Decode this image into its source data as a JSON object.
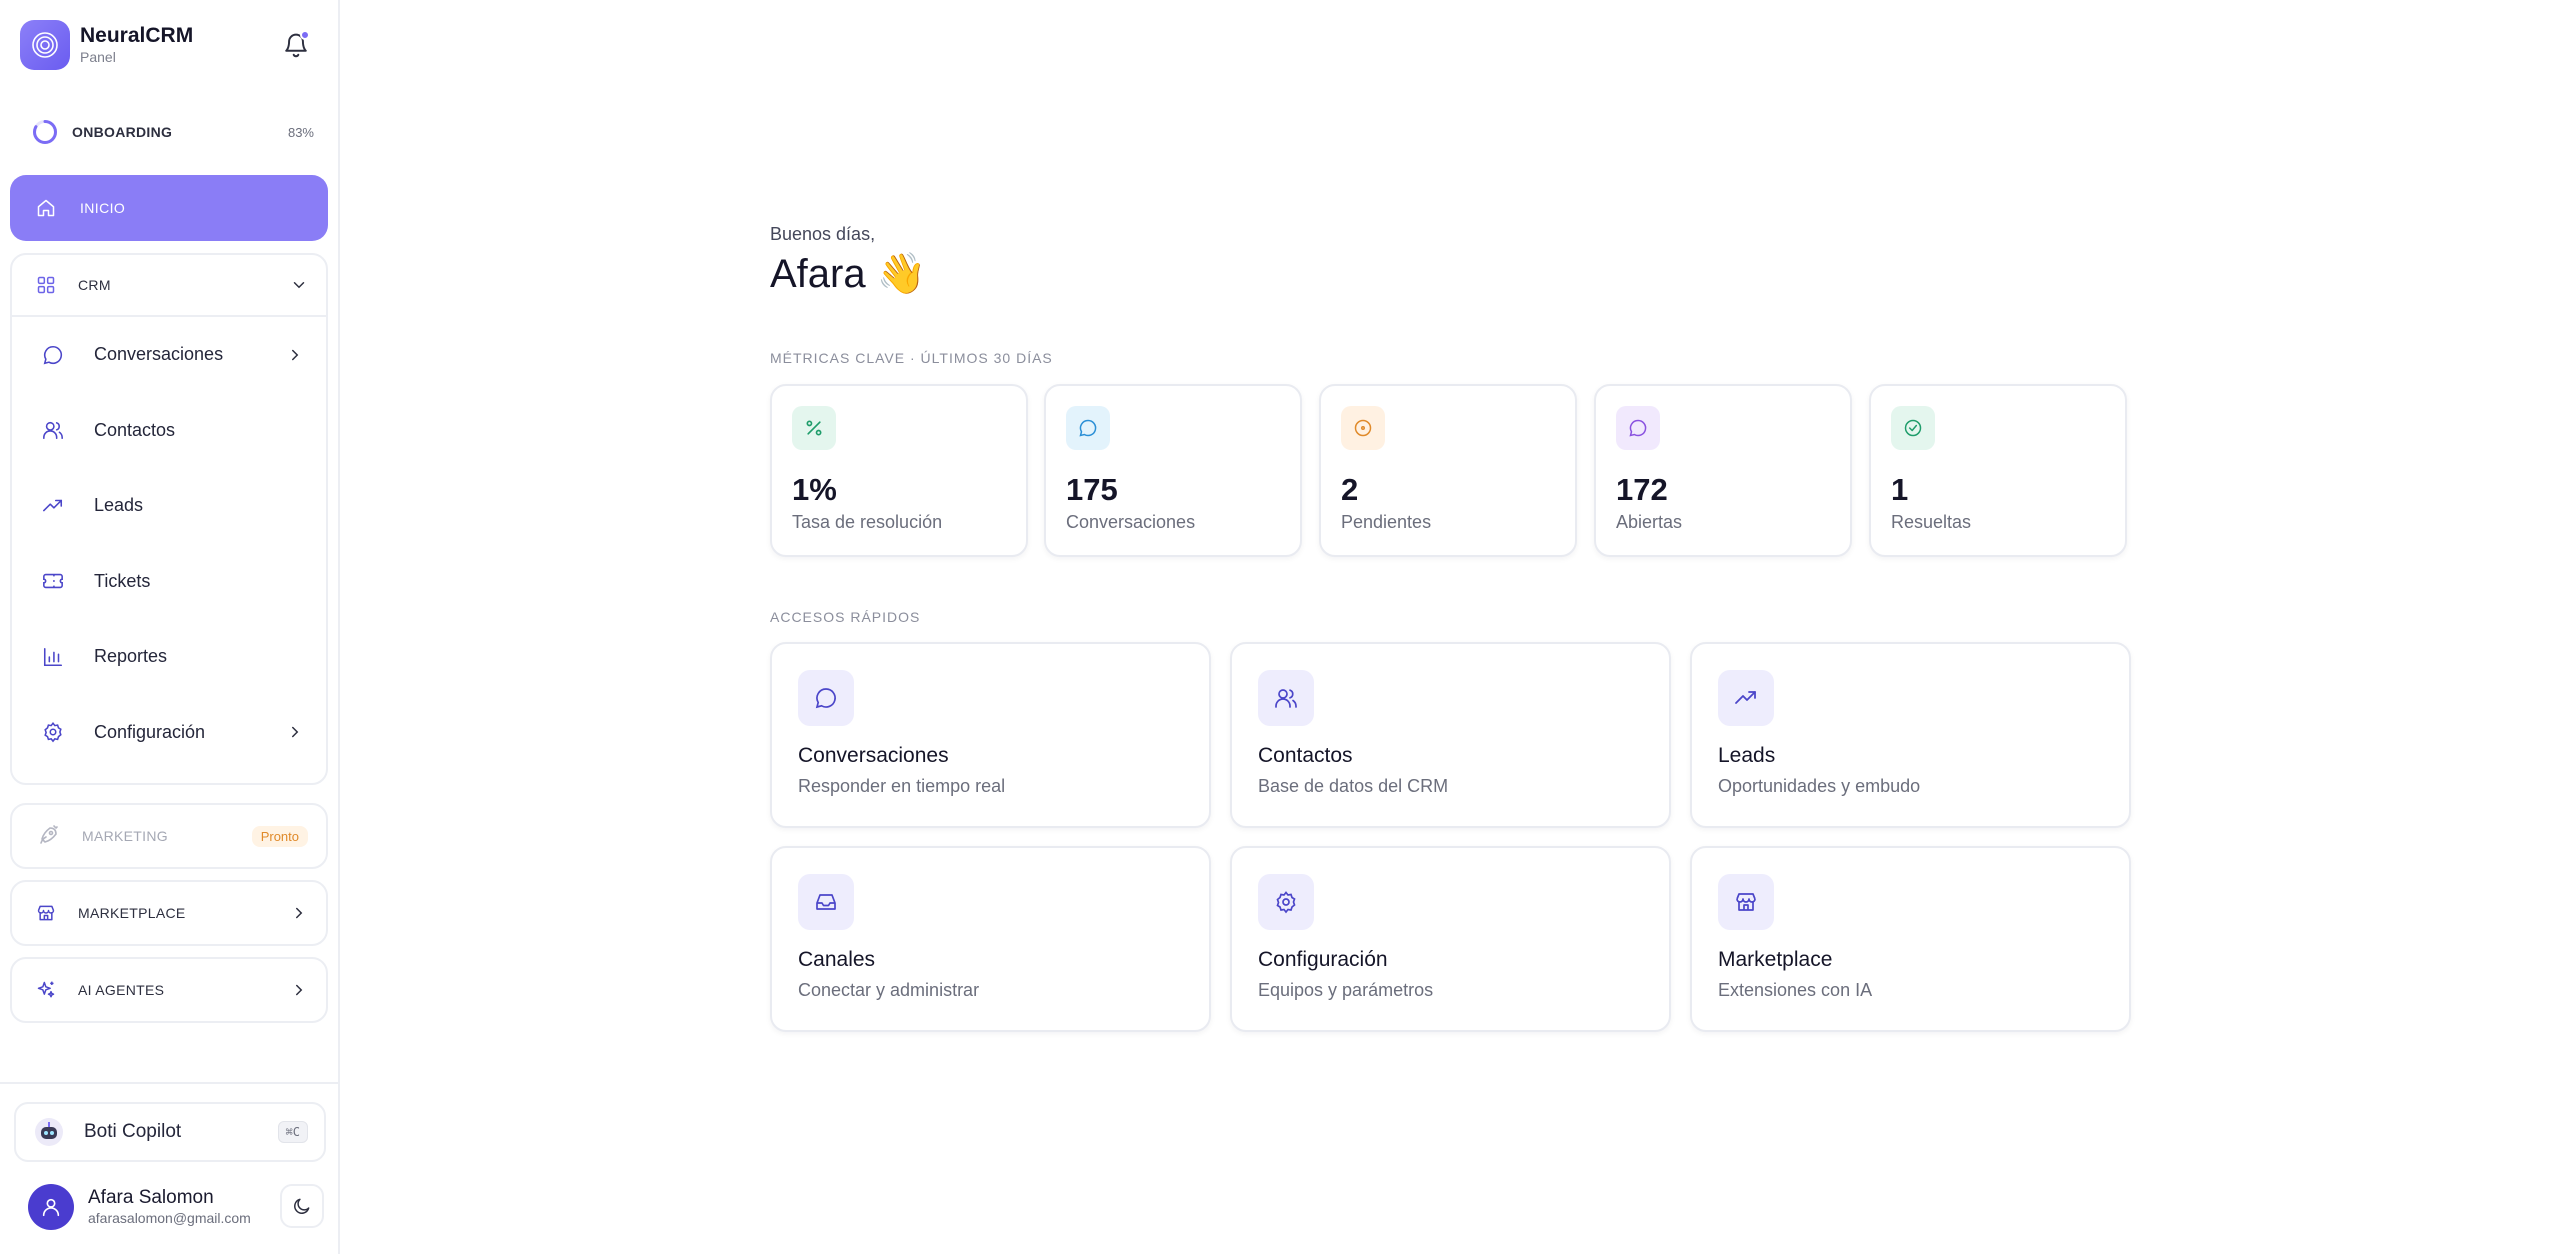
{
  "brand": {
    "name": "NeuralCRM",
    "subtitle": "Panel"
  },
  "onboarding": {
    "label": "ONBOARDING",
    "percent_text": "83%",
    "progress": 0.83
  },
  "nav": {
    "home_label": "INICIO",
    "crm_label": "CRM",
    "crm_items": [
      {
        "label": "Conversaciones",
        "icon": "chat-bubble-icon",
        "has_chevron": true
      },
      {
        "label": "Contactos",
        "icon": "users-icon",
        "has_chevron": false
      },
      {
        "label": "Leads",
        "icon": "trending-up-icon",
        "has_chevron": false
      },
      {
        "label": "Tickets",
        "icon": "ticket-icon",
        "has_chevron": false
      },
      {
        "label": "Reportes",
        "icon": "bar-chart-icon",
        "has_chevron": false
      },
      {
        "label": "Configuración",
        "icon": "gear-icon",
        "has_chevron": true
      }
    ],
    "marketing_label": "MARKETING",
    "marketing_badge": "Pronto",
    "marketplace_label": "MARKETPLACE",
    "ai_agents_label": "AI AGENTES"
  },
  "copilot": {
    "label": "Boti Copilot",
    "shortcut": "⌘C"
  },
  "user": {
    "name": "Afara Salomon",
    "email": "afarasalomon@gmail.com"
  },
  "greeting": {
    "line1": "Buenos días,",
    "name": "Afara 👋"
  },
  "metrics_section_label": "MÉTRICAS CLAVE · ÚLTIMOS 30 DÍAS",
  "metrics": [
    {
      "value": "1%",
      "label": "Tasa de resolución",
      "icon": "percent-icon",
      "color": "#1f9d6b",
      "bg": "#e4f6ee"
    },
    {
      "value": "175",
      "label": "Conversaciones",
      "icon": "chat-bubble-icon",
      "color": "#2b8fd6",
      "bg": "#e3f3fc"
    },
    {
      "value": "2",
      "label": "Pendientes",
      "icon": "clock-circle-icon",
      "color": "#e08a2a",
      "bg": "#fff1e2"
    },
    {
      "value": "172",
      "label": "Abiertas",
      "icon": "chat-bubble-icon",
      "color": "#8a52e0",
      "bg": "#f1e9fd"
    },
    {
      "value": "1",
      "label": "Resueltas",
      "icon": "check-circle-icon",
      "color": "#1f9d6b",
      "bg": "#e4f6ee"
    }
  ],
  "quick_section_label": "ACCESOS RÁPIDOS",
  "quick": [
    {
      "title": "Conversaciones",
      "desc": "Responder en tiempo real",
      "icon": "chat-bubble-icon"
    },
    {
      "title": "Contactos",
      "desc": "Base de datos del CRM",
      "icon": "users-icon"
    },
    {
      "title": "Leads",
      "desc": "Oportunidades y embudo",
      "icon": "trending-up-icon"
    },
    {
      "title": "Canales",
      "desc": "Conectar y administrar",
      "icon": "inbox-icon"
    },
    {
      "title": "Configuración",
      "desc": "Equipos y parámetros",
      "icon": "gear-icon"
    },
    {
      "title": "Marketplace",
      "desc": "Extensiones con IA",
      "icon": "store-icon"
    }
  ],
  "colors": {
    "accent": "#8a7df6",
    "accent_dark": "#4a3ccf",
    "icon_indigo": "#4b46c9"
  }
}
